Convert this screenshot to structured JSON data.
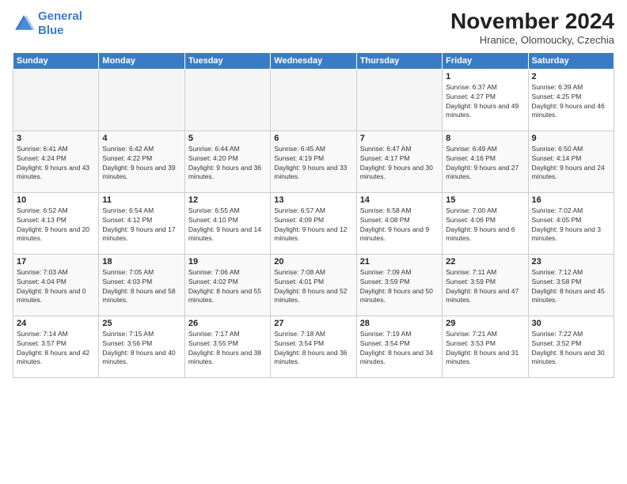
{
  "header": {
    "logo_line1": "General",
    "logo_line2": "Blue",
    "month": "November 2024",
    "location": "Hranice, Olomoucky, Czechia"
  },
  "weekdays": [
    "Sunday",
    "Monday",
    "Tuesday",
    "Wednesday",
    "Thursday",
    "Friday",
    "Saturday"
  ],
  "weeks": [
    [
      {
        "day": "",
        "info": ""
      },
      {
        "day": "",
        "info": ""
      },
      {
        "day": "",
        "info": ""
      },
      {
        "day": "",
        "info": ""
      },
      {
        "day": "",
        "info": ""
      },
      {
        "day": "1",
        "info": "Sunrise: 6:37 AM\nSunset: 4:27 PM\nDaylight: 9 hours and 49 minutes."
      },
      {
        "day": "2",
        "info": "Sunrise: 6:39 AM\nSunset: 4:25 PM\nDaylight: 9 hours and 46 minutes."
      }
    ],
    [
      {
        "day": "3",
        "info": "Sunrise: 6:41 AM\nSunset: 4:24 PM\nDaylight: 9 hours and 43 minutes."
      },
      {
        "day": "4",
        "info": "Sunrise: 6:42 AM\nSunset: 4:22 PM\nDaylight: 9 hours and 39 minutes."
      },
      {
        "day": "5",
        "info": "Sunrise: 6:44 AM\nSunset: 4:20 PM\nDaylight: 9 hours and 36 minutes."
      },
      {
        "day": "6",
        "info": "Sunrise: 6:45 AM\nSunset: 4:19 PM\nDaylight: 9 hours and 33 minutes."
      },
      {
        "day": "7",
        "info": "Sunrise: 6:47 AM\nSunset: 4:17 PM\nDaylight: 9 hours and 30 minutes."
      },
      {
        "day": "8",
        "info": "Sunrise: 6:49 AM\nSunset: 4:16 PM\nDaylight: 9 hours and 27 minutes."
      },
      {
        "day": "9",
        "info": "Sunrise: 6:50 AM\nSunset: 4:14 PM\nDaylight: 9 hours and 24 minutes."
      }
    ],
    [
      {
        "day": "10",
        "info": "Sunrise: 6:52 AM\nSunset: 4:13 PM\nDaylight: 9 hours and 20 minutes."
      },
      {
        "day": "11",
        "info": "Sunrise: 6:54 AM\nSunset: 4:12 PM\nDaylight: 9 hours and 17 minutes."
      },
      {
        "day": "12",
        "info": "Sunrise: 6:55 AM\nSunset: 4:10 PM\nDaylight: 9 hours and 14 minutes."
      },
      {
        "day": "13",
        "info": "Sunrise: 6:57 AM\nSunset: 4:09 PM\nDaylight: 9 hours and 12 minutes."
      },
      {
        "day": "14",
        "info": "Sunrise: 6:58 AM\nSunset: 4:08 PM\nDaylight: 9 hours and 9 minutes."
      },
      {
        "day": "15",
        "info": "Sunrise: 7:00 AM\nSunset: 4:06 PM\nDaylight: 9 hours and 6 minutes."
      },
      {
        "day": "16",
        "info": "Sunrise: 7:02 AM\nSunset: 4:05 PM\nDaylight: 9 hours and 3 minutes."
      }
    ],
    [
      {
        "day": "17",
        "info": "Sunrise: 7:03 AM\nSunset: 4:04 PM\nDaylight: 9 hours and 0 minutes."
      },
      {
        "day": "18",
        "info": "Sunrise: 7:05 AM\nSunset: 4:03 PM\nDaylight: 8 hours and 58 minutes."
      },
      {
        "day": "19",
        "info": "Sunrise: 7:06 AM\nSunset: 4:02 PM\nDaylight: 8 hours and 55 minutes."
      },
      {
        "day": "20",
        "info": "Sunrise: 7:08 AM\nSunset: 4:01 PM\nDaylight: 8 hours and 52 minutes."
      },
      {
        "day": "21",
        "info": "Sunrise: 7:09 AM\nSunset: 3:59 PM\nDaylight: 8 hours and 50 minutes."
      },
      {
        "day": "22",
        "info": "Sunrise: 7:11 AM\nSunset: 3:59 PM\nDaylight: 8 hours and 47 minutes."
      },
      {
        "day": "23",
        "info": "Sunrise: 7:12 AM\nSunset: 3:58 PM\nDaylight: 8 hours and 45 minutes."
      }
    ],
    [
      {
        "day": "24",
        "info": "Sunrise: 7:14 AM\nSunset: 3:57 PM\nDaylight: 8 hours and 42 minutes."
      },
      {
        "day": "25",
        "info": "Sunrise: 7:15 AM\nSunset: 3:56 PM\nDaylight: 8 hours and 40 minutes."
      },
      {
        "day": "26",
        "info": "Sunrise: 7:17 AM\nSunset: 3:55 PM\nDaylight: 8 hours and 38 minutes."
      },
      {
        "day": "27",
        "info": "Sunrise: 7:18 AM\nSunset: 3:54 PM\nDaylight: 8 hours and 36 minutes."
      },
      {
        "day": "28",
        "info": "Sunrise: 7:19 AM\nSunset: 3:54 PM\nDaylight: 8 hours and 34 minutes."
      },
      {
        "day": "29",
        "info": "Sunrise: 7:21 AM\nSunset: 3:53 PM\nDaylight: 8 hours and 31 minutes."
      },
      {
        "day": "30",
        "info": "Sunrise: 7:22 AM\nSunset: 3:52 PM\nDaylight: 8 hours and 30 minutes."
      }
    ]
  ]
}
